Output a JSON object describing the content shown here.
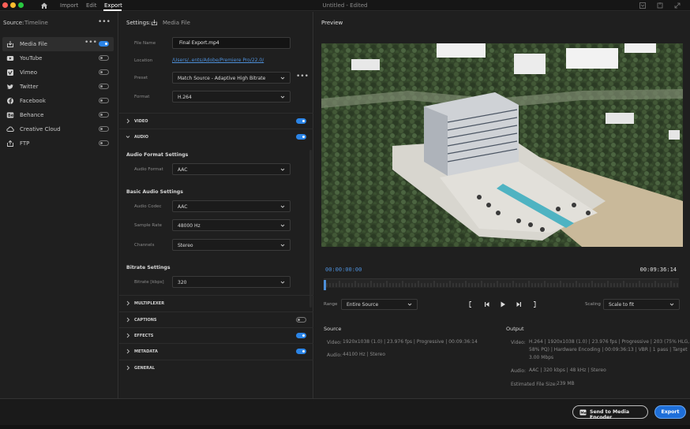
{
  "topbar": {
    "nav": [
      {
        "label": "Import"
      },
      {
        "label": "Edit"
      },
      {
        "label": "Export"
      }
    ],
    "title": "Untitled - Edited",
    "traffic_colors": [
      "#ff5f57",
      "#febc2e",
      "#28c840"
    ],
    "icons": [
      "home-icon",
      "quick-export-icon",
      "share-icon",
      "fullscreen-icon"
    ]
  },
  "source": {
    "label": "Source:",
    "value": "Timeline",
    "more": "•••"
  },
  "destinations": [
    {
      "label": "Media File",
      "icon": "media-file-icon",
      "enabled": true,
      "selected": true,
      "more": "•••"
    },
    {
      "label": "YouTube",
      "icon": "youtube-icon",
      "enabled": false
    },
    {
      "label": "Vimeo",
      "icon": "vimeo-icon",
      "enabled": false
    },
    {
      "label": "Twitter",
      "icon": "twitter-icon",
      "enabled": false
    },
    {
      "label": "Facebook",
      "icon": "facebook-icon",
      "enabled": false
    },
    {
      "label": "Behance",
      "icon": "behance-icon",
      "enabled": false
    },
    {
      "label": "Creative Cloud",
      "icon": "creative-cloud-icon",
      "enabled": false
    },
    {
      "label": "FTP",
      "icon": "ftp-icon",
      "enabled": false
    }
  ],
  "settings": {
    "title": "Settings:",
    "destination": "Media File",
    "file_name_label": "File Name",
    "file_name": "Final Export.mp4",
    "location_label": "Location",
    "location": "/Users/..ents/Adobe/Premiere Pro/22.0/",
    "preset_label": "Preset",
    "preset": "Match Source - Adaptive High Bitrate",
    "preset_more": "•••",
    "format_label": "Format",
    "format": "H.264",
    "sections": {
      "video": "VIDEO",
      "audio": "AUDIO",
      "multiplexer": "MULTIPLEXER",
      "captions": "CAPTIONS",
      "effects": "EFFECTS",
      "metadata": "METADATA",
      "general": "GENERAL"
    },
    "audio_format_settings": "Audio Format Settings",
    "audio_format_label": "Audio Format",
    "audio_format": "AAC",
    "basic_audio_settings": "Basic Audio Settings",
    "audio_codec_label": "Audio Codec",
    "audio_codec": "AAC",
    "sample_rate_label": "Sample Rate",
    "sample_rate": "48000 Hz",
    "channels_label": "Channels",
    "channels": "Stereo",
    "bitrate_settings": "Bitrate Settings",
    "bitrate_label": "Bitrate [kbps]",
    "bitrate": "320"
  },
  "preview": {
    "title": "Preview",
    "tc_in": "00:00:00:00",
    "tc_out": "00:09:36:14",
    "playhead_fraction": 0,
    "range_label": "Range",
    "range": "Entire Source",
    "scaling_label": "Scaling",
    "scaling": "Scale to fit"
  },
  "source_info": {
    "title": "Source",
    "video_label": "Video:",
    "video": "1920x1038 (1.0)  |  23.976 fps  |  Progressive  |  00:09:36:14",
    "audio_label": "Audio:",
    "audio": "44100 Hz  |  Stereo"
  },
  "output_info": {
    "title": "Output",
    "video_label": "Video:",
    "video_line1": "H.264  |  1920x1038 (1.0)  |  23.976 fps  |  Progressive  |  203 (75% HLG,",
    "video_line2": "58% PQ)  |  Hardware Encoding  |  00:09:36:13  |  VBR  |  1 pass  |  Target",
    "video_line3": "3.00 Mbps",
    "audio_label": "Audio:",
    "audio": "AAC  |  320 kbps  |  48 kHz  |  Stereo",
    "size_label": "Estimated File Size:",
    "size": "239 MB"
  },
  "buttons": {
    "send_to_media_encoder": "Send to Media Encoder",
    "export": "Export"
  },
  "colors": {
    "accent": "#2b84e6",
    "export_button": "#1e6fd9",
    "timecode": "#4d8fd9"
  }
}
